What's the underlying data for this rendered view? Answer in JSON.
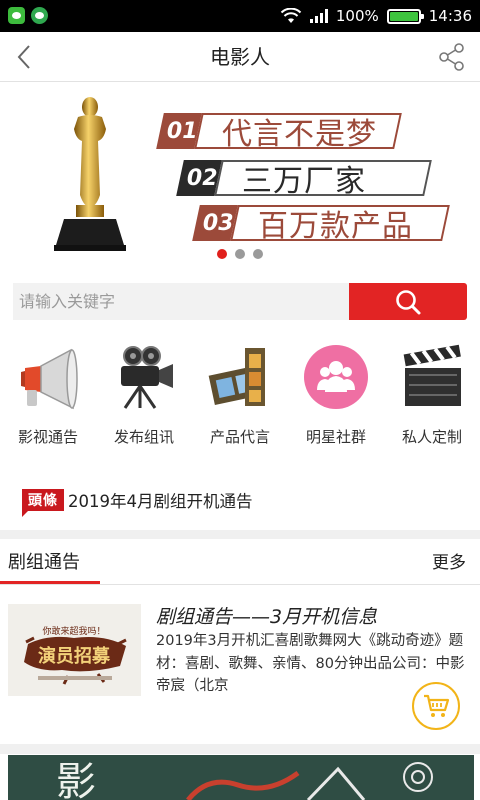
{
  "status_bar": {
    "battery": "100%",
    "time": "14:36",
    "battery_level": 1.0
  },
  "header": {
    "title": "电影人"
  },
  "banner": {
    "slogans": [
      {
        "num": "01",
        "text": "代言不是梦",
        "num_color": "#9c4a3a",
        "text_color": "#9c4a3a"
      },
      {
        "num": "02",
        "text": "三万厂家",
        "num_color": "#2a2a2a",
        "text_color": "#2a2a2a"
      },
      {
        "num": "03",
        "text": "百万款产品",
        "num_color": "#9c4a3a",
        "text_color": "#9c4a3a"
      }
    ],
    "active_dot": 0,
    "dot_count": 3
  },
  "search": {
    "placeholder": "请输入关键字",
    "value": ""
  },
  "categories": [
    {
      "label": "影视通告",
      "icon": "megaphone-icon"
    },
    {
      "label": "发布组讯",
      "icon": "film-camera-icon"
    },
    {
      "label": "产品代言",
      "icon": "film-strip-icon"
    },
    {
      "label": "明星社群",
      "icon": "group-icon"
    },
    {
      "label": "私人定制",
      "icon": "clapperboard-icon"
    }
  ],
  "headline": {
    "badge": "頭條",
    "text": "2019年4月剧组开机通告"
  },
  "section": {
    "title": "剧组通告",
    "more": "更多"
  },
  "notice": {
    "title": "剧组通告——3月开机信息",
    "description": "2019年3月开机汇喜剧歌舞网大《跳动奇迹》题材：喜剧、歌舞、亲情、80分钟出品公司：中影帝宸（北京",
    "thumb_tagline": "你敢来超我吗！",
    "thumb_text": "演员招募"
  },
  "bottom_banner": {
    "text": "影"
  },
  "colors": {
    "accent": "#e22424",
    "cart_ring": "#f2b418",
    "headline_badge": "#c9181e"
  }
}
